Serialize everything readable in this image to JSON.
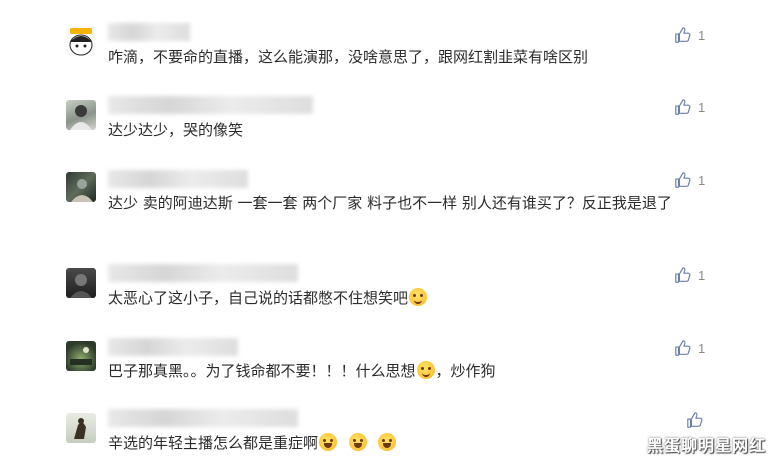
{
  "comments": [
    {
      "text": "咋滴，不要命的直播，这么能演那，没啥意思了，跟网红割韭菜有啥区别",
      "likes": "1",
      "nick_label": "",
      "emojis": []
    },
    {
      "text": "达少达少，哭的像笑",
      "likes": "1",
      "nick_label": "",
      "emojis": []
    },
    {
      "text": "达少 卖的阿迪达斯 一套一套 两个厂家 料子也不一样 别人还有谁买了？反正我是退了",
      "likes": "1",
      "nick_label": "",
      "emojis": []
    },
    {
      "text": "太恶心了这小子，自己说的话都憋不住想笑吧",
      "likes": "1",
      "nick_label": "",
      "emojis": [
        "thinking"
      ]
    },
    {
      "text_before": "巴子那真黑。。为了钱命都不要！！！什么思想",
      "text_after": "，炒作狗",
      "likes": "1",
      "emojis": [
        "confused"
      ]
    },
    {
      "text": "辛选的年轻主播怎么都是重症啊",
      "likes": "",
      "emojis": [
        "laugh",
        "laugh",
        "laugh"
      ]
    }
  ],
  "watermark": "黑蛋聊明星网红",
  "icons": {
    "like": "thumbs-up-icon"
  }
}
